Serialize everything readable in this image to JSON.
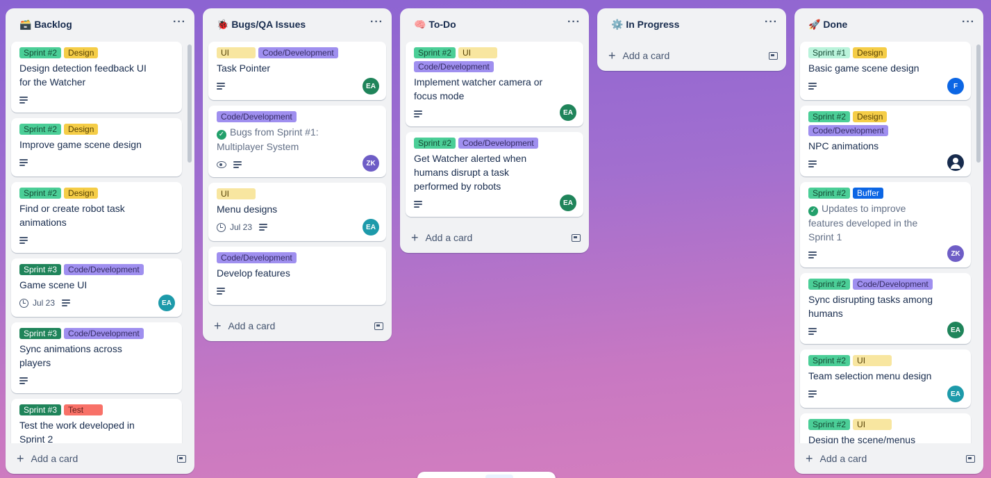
{
  "lists": [
    {
      "title": "🗃️ Backlog",
      "full": true,
      "add_label": "Add a card",
      "cards": [
        {
          "labels": [
            {
              "text": "Sprint #2",
              "cls": "l-green"
            },
            {
              "text": "Design",
              "cls": "l-yellow"
            }
          ],
          "title": "Design detection feedback UI for the Watcher",
          "desc": true
        },
        {
          "labels": [
            {
              "text": "Sprint #2",
              "cls": "l-green"
            },
            {
              "text": "Design",
              "cls": "l-yellow"
            }
          ],
          "title": "Improve game scene design",
          "desc": true
        },
        {
          "labels": [
            {
              "text": "Sprint #2",
              "cls": "l-green"
            },
            {
              "text": "Design",
              "cls": "l-yellow"
            }
          ],
          "title": "Find or create robot task animations",
          "desc": true
        },
        {
          "labels": [
            {
              "text": "Sprint #3",
              "cls": "l-dkgreen"
            },
            {
              "text": "Code/Development",
              "cls": "l-purple"
            }
          ],
          "title": "Game scene UI",
          "date": "Jul 23",
          "desc": true,
          "avatar": {
            "text": "EA",
            "cls": "av-teal"
          }
        },
        {
          "labels": [
            {
              "text": "Sprint #3",
              "cls": "l-dkgreen"
            },
            {
              "text": "Code/Development",
              "cls": "l-purple"
            }
          ],
          "title": "Sync animations across players",
          "desc": true
        },
        {
          "labels": [
            {
              "text": "Sprint #3",
              "cls": "l-dkgreen"
            },
            {
              "text": "Test",
              "cls": "l-red"
            }
          ],
          "title": "Test the work developed in Sprint 2",
          "desc": true
        }
      ]
    },
    {
      "title": "🐞 Bugs/QA Issues",
      "add_label": "Add a card",
      "cards": [
        {
          "labels": [
            {
              "text": "UI",
              "cls": "l-ltyellow"
            },
            {
              "text": "Code/Development",
              "cls": "l-purple"
            }
          ],
          "title": "Task Pointer",
          "desc": true,
          "avatar": {
            "text": "EA",
            "cls": "av-green"
          }
        },
        {
          "labels": [
            {
              "text": "Code/Development",
              "cls": "l-purple"
            }
          ],
          "title": "Bugs from Sprint #1: Multiplayer System",
          "done": true,
          "watch": true,
          "desc": true,
          "avatar": {
            "text": "ZK",
            "cls": "av-purple"
          }
        },
        {
          "labels": [
            {
              "text": "UI",
              "cls": "l-ltyellow"
            }
          ],
          "title": "Menu designs",
          "date": "Jul 23",
          "desc": true,
          "avatar": {
            "text": "EA",
            "cls": "av-teal"
          }
        },
        {
          "labels": [
            {
              "text": "Code/Development",
              "cls": "l-purple"
            }
          ],
          "title": "Develop features",
          "desc": true
        }
      ]
    },
    {
      "title": "🧠 To-Do",
      "add_label": "Add a card",
      "cards": [
        {
          "labels": [
            {
              "text": "Sprint #2",
              "cls": "l-green"
            },
            {
              "text": "UI",
              "cls": "l-ltyellow"
            },
            {
              "text": "Code/Development",
              "cls": "l-purple"
            }
          ],
          "title": "Implement watcher camera or focus mode",
          "desc": true,
          "avatar": {
            "text": "EA",
            "cls": "av-green"
          }
        },
        {
          "labels": [
            {
              "text": "Sprint #2",
              "cls": "l-green"
            },
            {
              "text": "Code/Development",
              "cls": "l-purple"
            }
          ],
          "title": "Get Watcher alerted when humans disrupt a task performed by robots",
          "desc": true,
          "avatar": {
            "text": "EA",
            "cls": "av-green"
          }
        }
      ]
    },
    {
      "title": "⚙️ In Progress",
      "add_label": "Add a card",
      "cards": []
    },
    {
      "title": "🚀 Done",
      "full": true,
      "add_label": "Add a card",
      "cards": [
        {
          "labels": [
            {
              "text": "Sprint #1",
              "cls": "l-ltgreen"
            },
            {
              "text": "Design",
              "cls": "l-yellow"
            }
          ],
          "title": "Basic game scene design",
          "desc": true,
          "avatar": {
            "text": "F",
            "cls": "av-blue"
          }
        },
        {
          "labels": [
            {
              "text": "Sprint #2",
              "cls": "l-green"
            },
            {
              "text": "Design",
              "cls": "l-yellow"
            },
            {
              "text": "Code/Development",
              "cls": "l-purple"
            }
          ],
          "title": "NPC animations",
          "desc": true,
          "avatar": {
            "text": "",
            "cls": "av-dark",
            "person": true
          }
        },
        {
          "labels": [
            {
              "text": "Sprint #2",
              "cls": "l-green"
            },
            {
              "text": "Buffer",
              "cls": "l-blue"
            }
          ],
          "title": "Updates to improve features developed in the Sprint 1",
          "done": true,
          "desc": true,
          "avatar": {
            "text": "ZK",
            "cls": "av-purple"
          }
        },
        {
          "labels": [
            {
              "text": "Sprint #2",
              "cls": "l-green"
            },
            {
              "text": "Code/Development",
              "cls": "l-purple"
            }
          ],
          "title": "Sync disrupting tasks among humans",
          "desc": true,
          "avatar": {
            "text": "EA",
            "cls": "av-green"
          }
        },
        {
          "labels": [
            {
              "text": "Sprint #2",
              "cls": "l-green"
            },
            {
              "text": "UI",
              "cls": "l-ltyellow"
            }
          ],
          "title": "Team selection menu design",
          "desc": true,
          "avatar": {
            "text": "EA",
            "cls": "av-teal"
          }
        },
        {
          "labels": [
            {
              "text": "Sprint #2",
              "cls": "l-green"
            },
            {
              "text": "UI",
              "cls": "l-ltyellow"
            }
          ],
          "title": "Design the scene/menus before the game scene",
          "desc": true
        }
      ]
    }
  ]
}
